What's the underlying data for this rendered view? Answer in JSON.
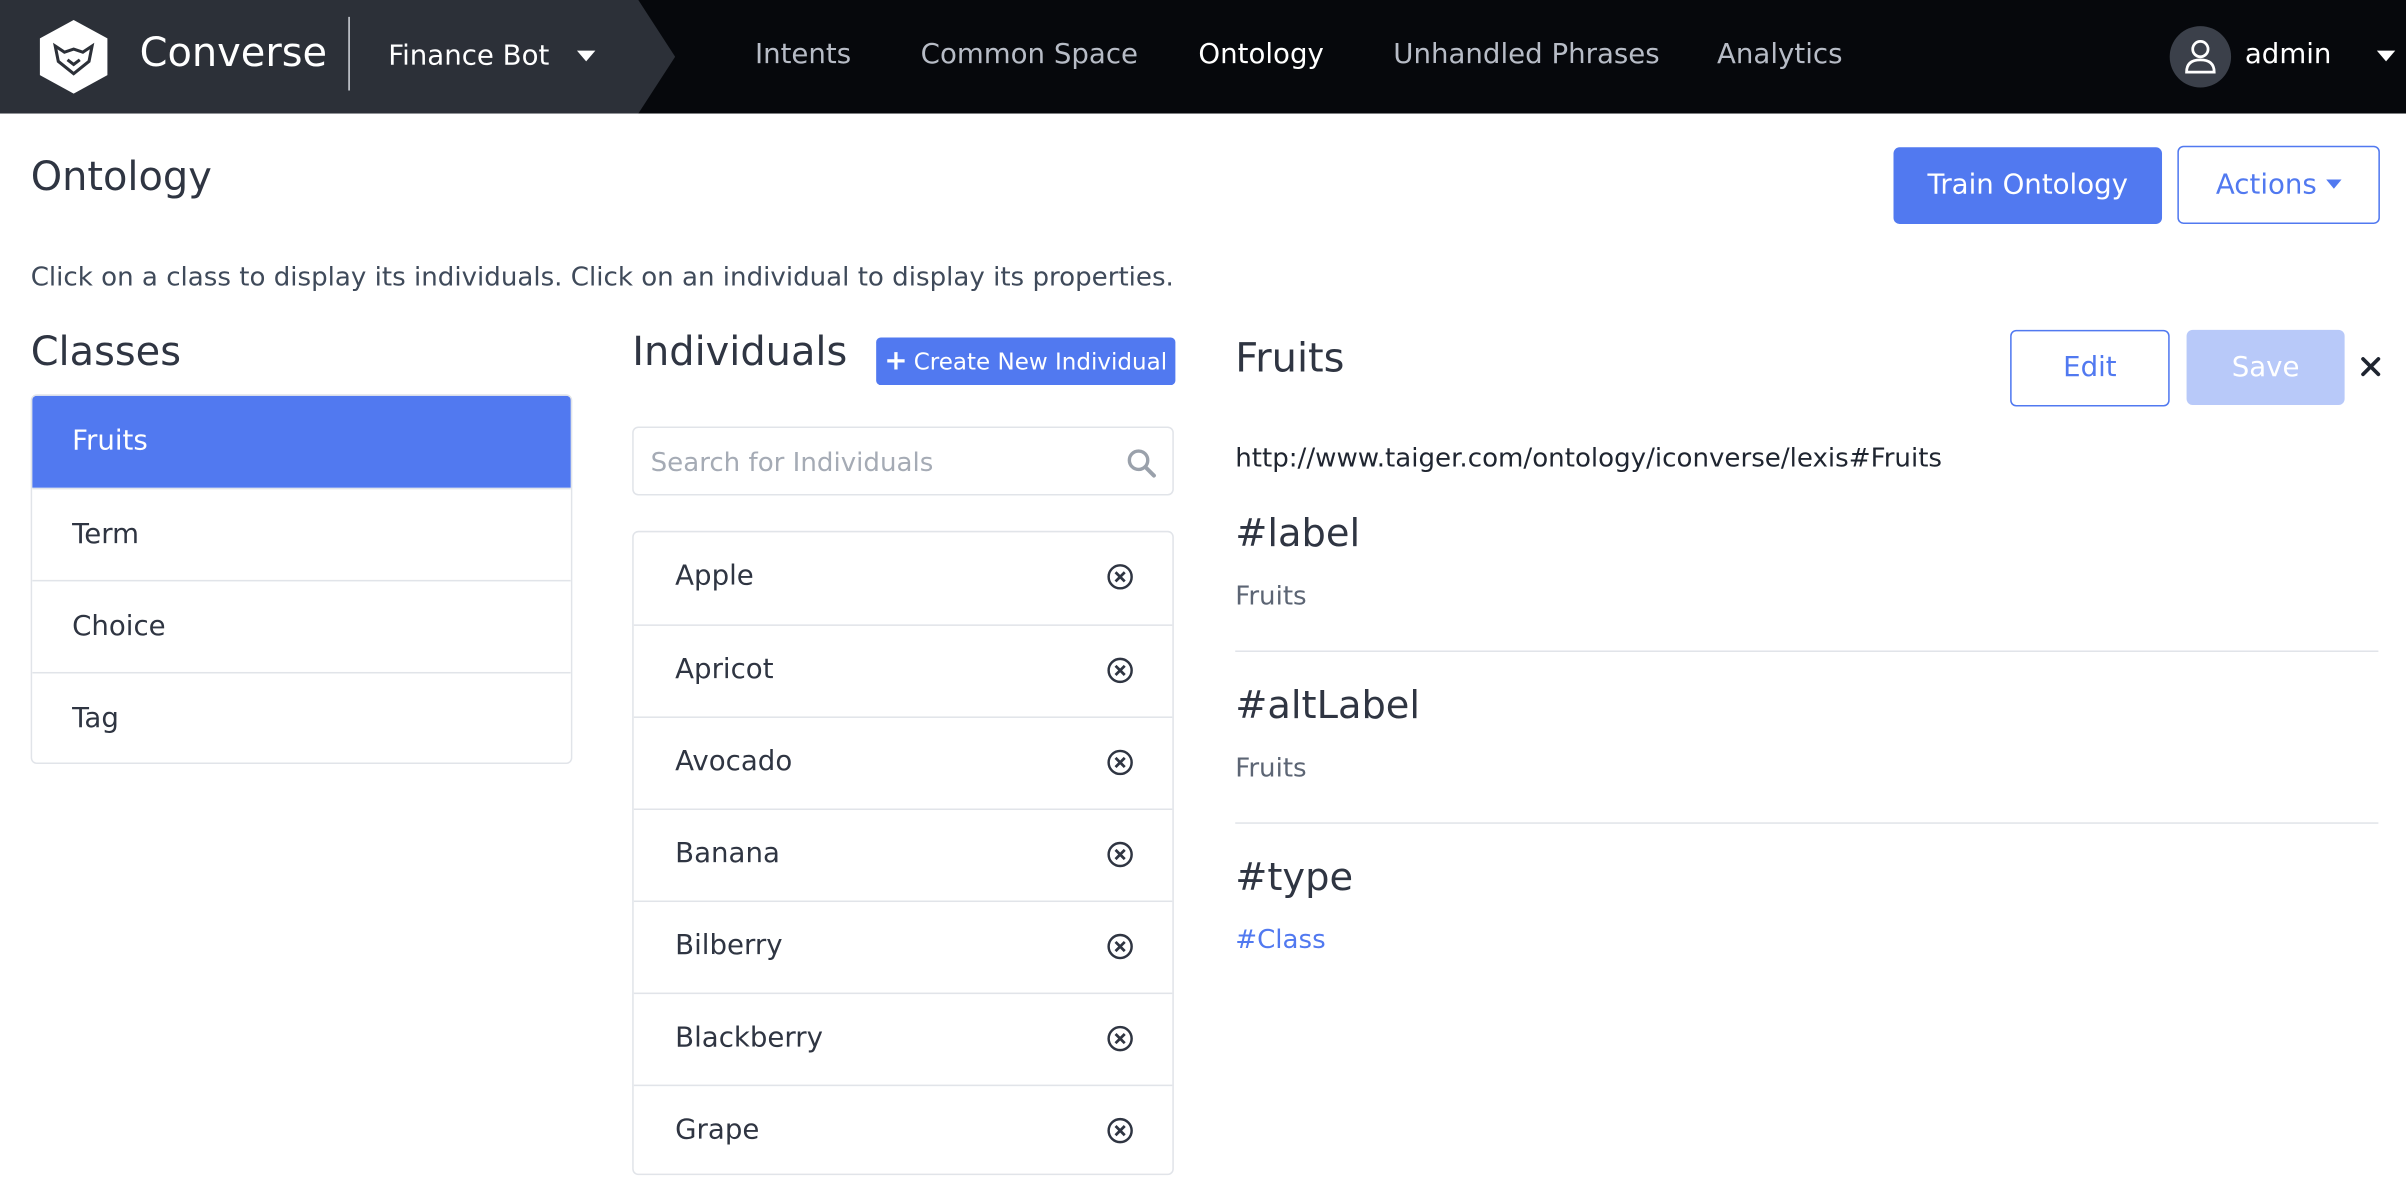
{
  "app": {
    "name": "Converse"
  },
  "nav": {
    "bot_name": "Finance Bot",
    "links": [
      "Intents",
      "Common Space",
      "Ontology",
      "Unhandled Phrases",
      "Analytics"
    ],
    "active": "Ontology",
    "user": "admin"
  },
  "header": {
    "title": "Ontology",
    "train_label": "Train Ontology",
    "actions_label": "Actions",
    "instructions": "Click on a class to display its individuals. Click on an individual to display its properties."
  },
  "classes": {
    "title": "Classes",
    "items": [
      {
        "label": "Fruits",
        "selected": true
      },
      {
        "label": "Term"
      },
      {
        "label": "Choice"
      },
      {
        "label": "Tag"
      }
    ]
  },
  "individuals": {
    "title": "Individuals",
    "create_label": "Create New Individual",
    "search_placeholder": "Search for Individuals",
    "items": [
      "Apple",
      "Apricot",
      "Avocado",
      "Banana",
      "Bilberry",
      "Blackberry",
      "Grape"
    ]
  },
  "details": {
    "title": "Fruits",
    "edit_label": "Edit",
    "save_label": "Save",
    "uri": "http://www.taiger.com/ontology/iconverse/lexis#Fruits",
    "properties": [
      {
        "name": "#label",
        "value": "Fruits"
      },
      {
        "name": "#altLabel",
        "value": "Fruits"
      },
      {
        "name": "#type",
        "value": "#Class"
      }
    ]
  },
  "colors": {
    "primary": "#5179f0",
    "nav_bg": "#06080c",
    "brand_bg": "#2c3038"
  }
}
